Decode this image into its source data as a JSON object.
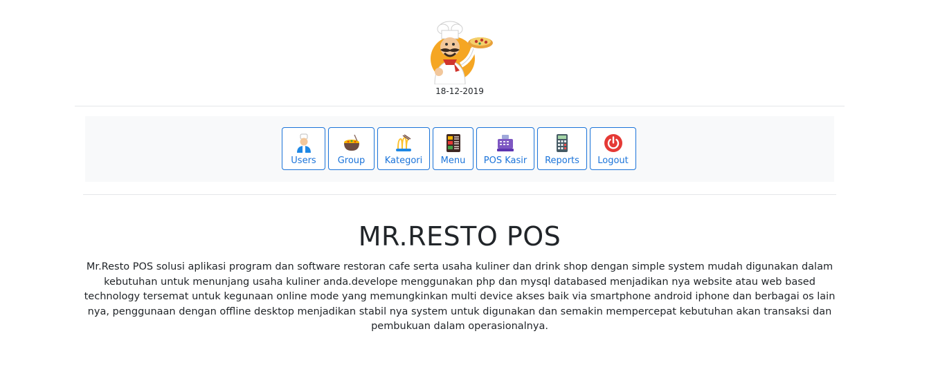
{
  "header": {
    "logo_icon": "chef-pizza-logo-icon",
    "date": "18-12-2019"
  },
  "nav": {
    "accent_color": "#1a73d9",
    "items": [
      {
        "label": "Users",
        "icon": "user-chef-icon"
      },
      {
        "label": "Group",
        "icon": "bowl-icon"
      },
      {
        "label": "Kategori",
        "icon": "noodles-icon"
      },
      {
        "label": "Menu",
        "icon": "menu-board-icon"
      },
      {
        "label": "POS Kasir",
        "icon": "cash-register-icon"
      },
      {
        "label": "Reports",
        "icon": "calculator-icon"
      },
      {
        "label": "Logout",
        "icon": "power-icon"
      }
    ]
  },
  "main": {
    "title": "MR.RESTO POS",
    "description": "Mr.Resto POS solusi aplikasi program dan software restoran cafe serta usaha kuliner dan drink shop dengan simple system mudah digunakan dalam kebutuhan untuk menunjang usaha kuliner anda.develope menggunakan php dan mysql databased menjadikan nya website atau web based technology tersemat untuk kegunaan online mode yang memungkinkan multi device akses baik via smartphone android iphone dan berbagai os lain nya, penggunaan dengan offline desktop menjadikan stabil nya system untuk digunakan dan semakin mempercepat kebutuhan akan transaksi dan pembukuan dalam operasionalnya."
  }
}
